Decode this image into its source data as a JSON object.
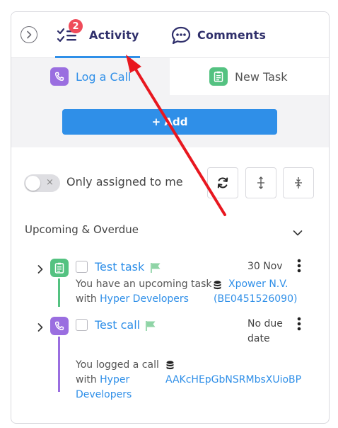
{
  "header": {
    "activity_tab": {
      "label": "Activity",
      "badge": "2"
    },
    "comments_tab": {
      "label": "Comments"
    }
  },
  "subtabs": {
    "log_call": "Log a Call",
    "new_task": "New Task"
  },
  "add_button": "+ Add",
  "filter": {
    "toggle_off_symbol": "×",
    "toggle_label": "Only assigned to me"
  },
  "section": {
    "title": "Upcoming & Overdue"
  },
  "items": [
    {
      "title": "Test task",
      "due": "30 Nov",
      "desc_line1": "You have an upcoming task",
      "desc_line2_prefix": "with ",
      "desc_line2_link": "Hyper Developers",
      "entity_line1": "Xpower N.V.",
      "entity_line2": "(BE0451526090)"
    },
    {
      "title": "Test call",
      "due_line1": "No due",
      "due_line2": "date",
      "desc_line1": "You logged a call",
      "desc_line2_prefix": "with ",
      "desc_line2_link": "Hyper",
      "desc_line3_link": "Developers",
      "entity_line1": "AAKcHEpGbNSRMbsXUioBP"
    }
  ],
  "colors": {
    "accent": "#2f8fe8",
    "badge": "#ef4b5a",
    "task_green": "#54c281",
    "call_purple": "#9a6ee0",
    "annotation_arrow": "#e8171f"
  }
}
